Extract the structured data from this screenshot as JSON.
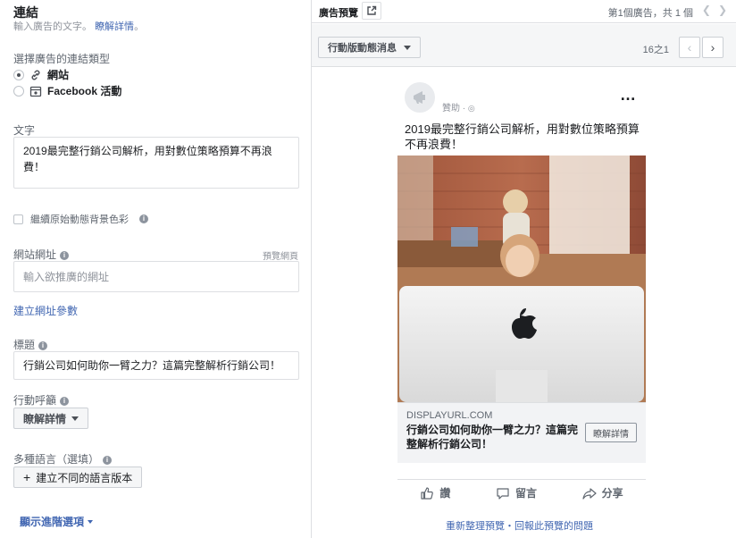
{
  "link_section": {
    "title": "連結",
    "subtitle": "輸入廣告的文字。",
    "learn_more": "瞭解詳情",
    "learn_more_tail": "。"
  },
  "link_type": {
    "label": "選擇廣告的連結類型",
    "options": [
      {
        "label": "網站",
        "selected": true,
        "icon": "link-icon"
      },
      {
        "label": "Facebook 活動",
        "selected": false,
        "icon": "calendar-icon"
      }
    ]
  },
  "text_field": {
    "label": "文字",
    "value": "2019最完整行銷公司解析，用對數位策略預算不再浪費！"
  },
  "bg_option": {
    "label": "繼續原始動態背景色彩"
  },
  "website": {
    "label": "網站網址",
    "preview_link": "預覽網頁",
    "placeholder": "輸入欲推廣的網址",
    "build_params": "建立網址參數"
  },
  "headline_field": {
    "label": "標題",
    "value": "行銷公司如何助你一臂之力？這篇完整解析行銷公司！"
  },
  "cta_field": {
    "label": "行動呼籲",
    "value": "瞭解詳情"
  },
  "languages": {
    "label": "多種語言",
    "optional": "（選填）",
    "button": "建立不同的語言版本",
    "plus": "+"
  },
  "advanced": {
    "label": "顯示進階選項"
  },
  "preview": {
    "title": "廣告預覽",
    "page_indicator": "第1個廣告，共 1 個",
    "placement": "行動版動態消息",
    "count": "16之1",
    "sponsored": "贊助",
    "primary_text": "2019最完整行銷公司解析，用對數位策略預算不再浪費！",
    "display_url": "DISPLAYURL.COM",
    "headline": "行銷公司如何助你一臂之力？這篇完整解析行銷公司！",
    "cta": "瞭解詳情",
    "like": "讚",
    "comment": "留言",
    "share": "分享",
    "footer_refresh": "重新整理預覽",
    "footer_sep": "・",
    "footer_report": "回報此預覽的問題"
  },
  "colors": {
    "link": "#4267b2",
    "muted": "#90949c",
    "border": "#dddfe2",
    "panel_bg": "#f5f6f7"
  }
}
